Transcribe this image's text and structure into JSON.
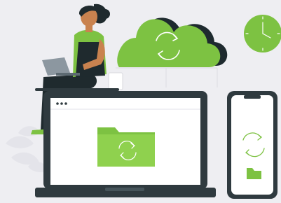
{
  "scene": {
    "background_color": "#eeeef2",
    "accent_color": "#7dc242",
    "dark_color": "#2f3a3f",
    "elements": {
      "cloud": {
        "icon": "sync-icon"
      },
      "clock": {
        "icon": "clock-icon"
      },
      "laptop": {
        "window_controls": 3,
        "folder_icon": "folder-sync-icon"
      },
      "phone": {
        "icons": [
          "sync-icon",
          "folder-icon"
        ]
      },
      "person": {
        "device": "laptop-icon"
      }
    }
  }
}
